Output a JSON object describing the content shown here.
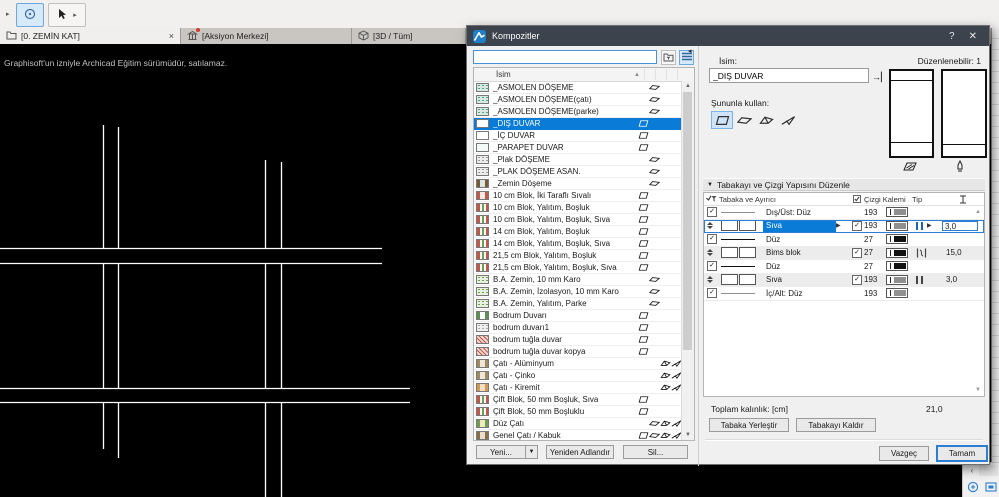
{
  "window": {
    "tabs": [
      {
        "label": "[0. ZEMİN KAT]",
        "icon": "floor-plan"
      },
      {
        "label": "[Aksiyon Merkezi]",
        "icon": "action-center"
      },
      {
        "label": "[3D / Tüm]",
        "icon": "3d-view"
      }
    ],
    "canvas_notice": "Graphisoft'un izniyle Archicad Eğitim sürümüdür, satılamaz.",
    "plan_line_color": "#ffffff",
    "plan_segments": [
      [
        103.5,
        81,
        103.5,
        204.5
      ],
      [
        103.5,
        219.5,
        103.5,
        344.5
      ],
      [
        103.5,
        358.5,
        103.5,
        405
      ],
      [
        118.5,
        83,
        118.5,
        204.5
      ],
      [
        118.5,
        219.5,
        118.5,
        344.5
      ],
      [
        118.5,
        358.5,
        118.5,
        414
      ],
      [
        265.5,
        116,
        265.5,
        204.5
      ],
      [
        265.5,
        219.5,
        265.5,
        344.5
      ],
      [
        265.5,
        358.5,
        265.5,
        453
      ],
      [
        281.5,
        118,
        281.5,
        204.5
      ],
      [
        281.5,
        219.5,
        281.5,
        344.5
      ],
      [
        281.5,
        358.5,
        281.5,
        453
      ],
      [
        0,
        204.5,
        382,
        204.5
      ],
      [
        0,
        219.5,
        382,
        219.5
      ],
      [
        0,
        344.5,
        410,
        344.5
      ],
      [
        0,
        358.5,
        410,
        358.5
      ]
    ]
  },
  "dialog": {
    "title": "Kompozitler",
    "search": {
      "value": ""
    },
    "list": {
      "name_header": "İsim",
      "selected_name": "_DIŞ DUVAR",
      "items": [
        {
          "name": "_ASMOLEN DÖŞEME",
          "usage": [
            "slab"
          ],
          "sw": [
            "#d6eae3",
            "#53a28c",
            "dots"
          ]
        },
        {
          "name": "_ASMOLEN DÖŞEME(çatı)",
          "usage": [
            "slab"
          ],
          "sw": [
            "#d6eae3",
            "#53a28c",
            "dots"
          ]
        },
        {
          "name": "_ASMOLEN DÖŞEME(parke)",
          "usage": [
            "slab"
          ],
          "sw": [
            "#d6eae3",
            "#53a28c",
            "dots"
          ]
        },
        {
          "name": "_DIŞ DUVAR",
          "usage": [
            "wall"
          ],
          "sw": [
            "#ffffff",
            "#888888",
            "plain"
          ]
        },
        {
          "name": "_İÇ DUVAR",
          "usage": [
            "wall"
          ],
          "sw": [
            "#ffffff",
            "#888888",
            "plain"
          ]
        },
        {
          "name": "_PARAPET DUVAR",
          "usage": [
            "wall"
          ],
          "sw": [
            "#f2faf7",
            "#53a28c",
            "plain"
          ]
        },
        {
          "name": "_Plak DÖŞEME",
          "usage": [
            "slab"
          ],
          "sw": [
            "#ececec",
            "#9b9b9b",
            "dots"
          ]
        },
        {
          "name": "_PLAK DÖŞEME ASAN.",
          "usage": [
            "slab"
          ],
          "sw": [
            "#ececec",
            "#9b9b9b",
            "dots"
          ]
        },
        {
          "name": "_Zemin Döşeme",
          "usage": [
            "slab"
          ],
          "sw": [
            "#d6eae3",
            "#7a5a34",
            "bands"
          ]
        },
        {
          "name": "10 cm Blok, İki Taraflı Sıvalı",
          "usage": [
            "wall"
          ],
          "sw": [
            "#f7e9e4",
            "#c2574a",
            "bands"
          ]
        },
        {
          "name": "10 cm Blok, Yalıtım, Boşluk",
          "usage": [
            "wall"
          ],
          "sw": [
            "#ffffff",
            "#c2574a",
            "triband"
          ]
        },
        {
          "name": "10 cm Blok, Yalıtım, Boşluk, Sıva",
          "usage": [
            "wall"
          ],
          "sw": [
            "#ffffff",
            "#c2574a",
            "triband"
          ]
        },
        {
          "name": "14 cm Blok, Yalıtım, Boşluk",
          "usage": [
            "wall"
          ],
          "sw": [
            "#ffffff",
            "#c2574a",
            "triband"
          ]
        },
        {
          "name": "14 cm Blok, Yalıtım, Boşluk, Sıva",
          "usage": [
            "wall"
          ],
          "sw": [
            "#ffffff",
            "#c2574a",
            "triband"
          ]
        },
        {
          "name": "21,5 cm Blok, Yalıtım, Boşluk",
          "usage": [
            "wall"
          ],
          "sw": [
            "#ffffff",
            "#c2574a",
            "triband"
          ]
        },
        {
          "name": "21,5 cm Blok, Yalıtım, Boşluk, Sıva",
          "usage": [
            "wall"
          ],
          "sw": [
            "#ffffff",
            "#c2574a",
            "triband"
          ]
        },
        {
          "name": "B.A. Zemin, 10 mm Karo",
          "usage": [
            "slab"
          ],
          "sw": [
            "#e8f0e0",
            "#6f9e4f",
            "dots"
          ]
        },
        {
          "name": "B.A. Zemin, İzolasyon, 10 mm Karo",
          "usage": [
            "slab"
          ],
          "sw": [
            "#e8f0e0",
            "#6f9e4f",
            "dots"
          ]
        },
        {
          "name": "B.A. Zemin, Yalıtım, Parke",
          "usage": [
            "slab"
          ],
          "sw": [
            "#e8f0e0",
            "#6f9e4f",
            "dots"
          ]
        },
        {
          "name": "Bodrum Duvarı",
          "usage": [
            "wall"
          ],
          "sw": [
            "#ffffff",
            "#5d8f51",
            "bands"
          ]
        },
        {
          "name": "bodrum duvarı1",
          "usage": [
            "wall"
          ],
          "sw": [
            "#efefef",
            "#aaaaaa",
            "dots"
          ]
        },
        {
          "name": "bodrum tuğla duvar",
          "usage": [
            "wall"
          ],
          "sw": [
            "#f3d9d2",
            "#c2574a",
            "brick"
          ]
        },
        {
          "name": "bodrum tuğla duvar kopya",
          "usage": [
            "wall"
          ],
          "sw": [
            "#f3d9d2",
            "#c2574a",
            "brick"
          ]
        },
        {
          "name": "Çatı - Alüminyum",
          "usage": [
            "roof",
            "shell"
          ],
          "sw": [
            "#efe7d9",
            "#a08a64",
            "bands"
          ]
        },
        {
          "name": "Çatı - Çinko",
          "usage": [
            "roof",
            "shell"
          ],
          "sw": [
            "#efe7d9",
            "#a08a64",
            "bands"
          ]
        },
        {
          "name": "Çatı - Kiremit",
          "usage": [
            "roof",
            "shell"
          ],
          "sw": [
            "#f2dfc4",
            "#cf9a52",
            "bands"
          ]
        },
        {
          "name": "Çift Blok, 50 mm Boşluk, Sıva",
          "usage": [
            "wall"
          ],
          "sw": [
            "#ffffff",
            "#c2574a",
            "triband"
          ]
        },
        {
          "name": "Çift Blok, 50 mm Boşluklu",
          "usage": [
            "wall"
          ],
          "sw": [
            "#ffffff",
            "#c2574a",
            "triband"
          ]
        },
        {
          "name": "Düz Çatı",
          "usage": [
            "slab",
            "roof",
            "shell"
          ],
          "sw": [
            "#f0e8c0",
            "#6f9e4f",
            "bands"
          ]
        },
        {
          "name": "Genel Çatı / Kabuk",
          "usage": [
            "wall",
            "slab",
            "roof",
            "shell"
          ],
          "sw": [
            "#e9ddcc",
            "#8a6f4b",
            "bands"
          ]
        }
      ]
    },
    "list_buttons": {
      "new": "Yeni...",
      "rename": "Yeniden Adlandır",
      "delete": "Sil..."
    },
    "editor": {
      "name_label": "İsim:",
      "editable_label": "Düzenlenebilir: 1",
      "name_value": "_DIŞ DUVAR",
      "use_with_label": "Şununla kullan:",
      "use_with": {
        "options": [
          "wall",
          "slab",
          "roof",
          "shell"
        ],
        "selected": "wall"
      },
      "section_title": "Tabakayı ve Çizgi Yapısını Düzenle",
      "table": {
        "col_skin": "Tabaka ve Ayırıcı",
        "col_pen": "Çizgi Kalemi",
        "col_type": "Tip",
        "rows": [
          {
            "kind": "separator",
            "label": "Dış/Üst: Düz",
            "pen": "193",
            "tone": "gray",
            "checked": true
          },
          {
            "kind": "skin",
            "label": "Sıva",
            "pen": "193",
            "tone": "gray",
            "pen_checked": true,
            "tip": "bars",
            "thickness": "3,0",
            "selected": true
          },
          {
            "kind": "separator",
            "label": "Düz",
            "pen": "27",
            "tone": "black",
            "checked": true
          },
          {
            "kind": "skin",
            "label": "Bims blok",
            "pen": "27",
            "tone": "black",
            "pen_checked": true,
            "tip": "core",
            "thickness": "15,0"
          },
          {
            "kind": "separator",
            "label": "Düz",
            "pen": "27",
            "tone": "black",
            "checked": true
          },
          {
            "kind": "skin",
            "label": "Sıva",
            "pen": "193",
            "tone": "gray",
            "pen_checked": true,
            "tip": "bars",
            "thickness": "3,0"
          },
          {
            "kind": "separator",
            "label": "İç/Alt: Düz",
            "pen": "193",
            "tone": "gray",
            "checked": true
          }
        ]
      },
      "total_label": "Toplam kalınlık: [cm]",
      "total_value": "21,0",
      "insert_skin_button": "Tabaka Yerleştir",
      "remove_skin_button": "Tabakayı Kaldır"
    },
    "footer": {
      "cancel": "Vazgeç",
      "ok": "Tamam"
    }
  },
  "colors": {
    "selection": "#0b7bd8",
    "titlebar": "#3c434c",
    "accent": "#2a7fd4"
  }
}
